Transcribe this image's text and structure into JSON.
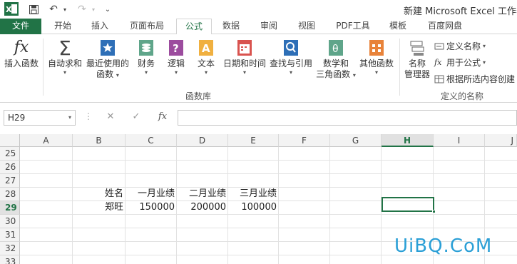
{
  "title_bar": {
    "window_title": "新建 Microsoft Excel 工作表"
  },
  "tabs": [
    {
      "label": "文件"
    },
    {
      "label": "开始"
    },
    {
      "label": "插入"
    },
    {
      "label": "页面布局"
    },
    {
      "label": "公式"
    },
    {
      "label": "数据"
    },
    {
      "label": "审阅"
    },
    {
      "label": "视图"
    },
    {
      "label": "PDF工具"
    },
    {
      "label": "模板"
    },
    {
      "label": "百度网盘"
    }
  ],
  "ribbon": {
    "insert_function": "插入函数",
    "autosum": "自动求和",
    "recent_line1": "最近使用的",
    "recent_line2": "函数",
    "financial": "财务",
    "logical": "逻辑",
    "text": "文本",
    "datetime": "日期和时间",
    "lookup": "查找与引用",
    "math_line1": "数学和",
    "math_line2": "三角函数",
    "more": "其他函数",
    "name_mgr_line1": "名称",
    "name_mgr_line2": "管理器",
    "define_name": "定义名称",
    "use_in_formula": "用于公式",
    "create_from_selection": "根据所选内容创建",
    "group_library": "函数库",
    "group_names": "定义的名称"
  },
  "formula_bar": {
    "name_box": "H29",
    "fx": "fx",
    "formula": ""
  },
  "columns": [
    "A",
    "B",
    "C",
    "D",
    "E",
    "F",
    "G",
    "H",
    "I",
    "J"
  ],
  "rows": [
    "25",
    "26",
    "27",
    "28",
    "29",
    "30",
    "31",
    "32",
    "33"
  ],
  "cells": {
    "B28": "姓名",
    "C28": "一月业绩",
    "D28": "二月业绩",
    "E28": "三月业绩",
    "B29": "郑旺",
    "C29": "150000",
    "D29": "200000",
    "E29": "100000"
  },
  "watermark": "UiBQ.CoM",
  "colors": {
    "excel_green": "#217346",
    "watermark": "#2a9fd6"
  }
}
